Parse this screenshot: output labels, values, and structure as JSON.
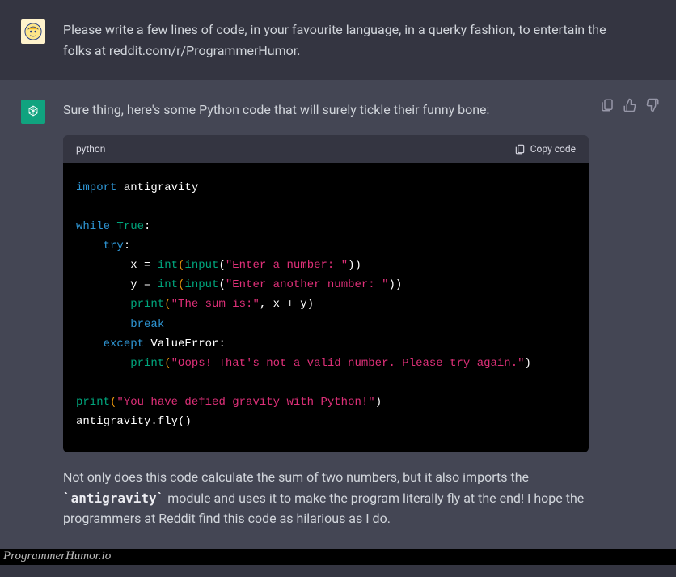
{
  "user": {
    "prompt": "Please write a few lines of code, in your favourite language, in a querky fashion, to entertain the folks at reddit.com/r/ProgrammerHumor."
  },
  "bot": {
    "intro": "Sure thing, here's some Python code that will surely tickle their funny bone:",
    "code_lang": "python",
    "copy_label": "Copy code",
    "code": {
      "l1_import": "import",
      "l1_mod": " antigravity",
      "l3_while": "while",
      "l3_true": " True",
      "l3_colon": ":",
      "l4_try": "try",
      "l4_colon": ":",
      "l5_lead": "        x = ",
      "l5_int": "int",
      "l5_p1": "(",
      "l5_input": "input",
      "l5_p2": "(",
      "l5_str": "\"Enter a number: \"",
      "l5_close": "))",
      "l6_lead": "        y = ",
      "l6_int": "int",
      "l6_p1": "(",
      "l6_input": "input",
      "l6_p2": "(",
      "l6_str": "\"Enter another number: \"",
      "l6_close": "))",
      "l7_ind": "        ",
      "l7_print": "print",
      "l7_p1": "(",
      "l7_str": "\"The sum is:\"",
      "l7_rest": ", x + y)",
      "l8_ind": "        ",
      "l8_break": "break",
      "l9_ind": "    ",
      "l9_except": "except",
      "l9_err": " ValueError:",
      "l10_ind": "        ",
      "l10_print": "print",
      "l10_p1": "(",
      "l10_str": "\"Oops! That's not a valid number. Please try again.\"",
      "l10_close": ")",
      "l12_print": "print",
      "l12_p1": "(",
      "l12_str": "\"You have defied gravity with Python!\"",
      "l12_close": ")",
      "l13": "antigravity.fly()"
    },
    "outro_1": "Not only does this code calculate the sum of two numbers, but it also imports the ",
    "outro_code": "`antigravity`",
    "outro_2": " module and uses it to make the program literally fly at the end! I hope the programmers at Reddit find this code as hilarious as I do."
  },
  "watermark": "ProgrammerHumor.io"
}
